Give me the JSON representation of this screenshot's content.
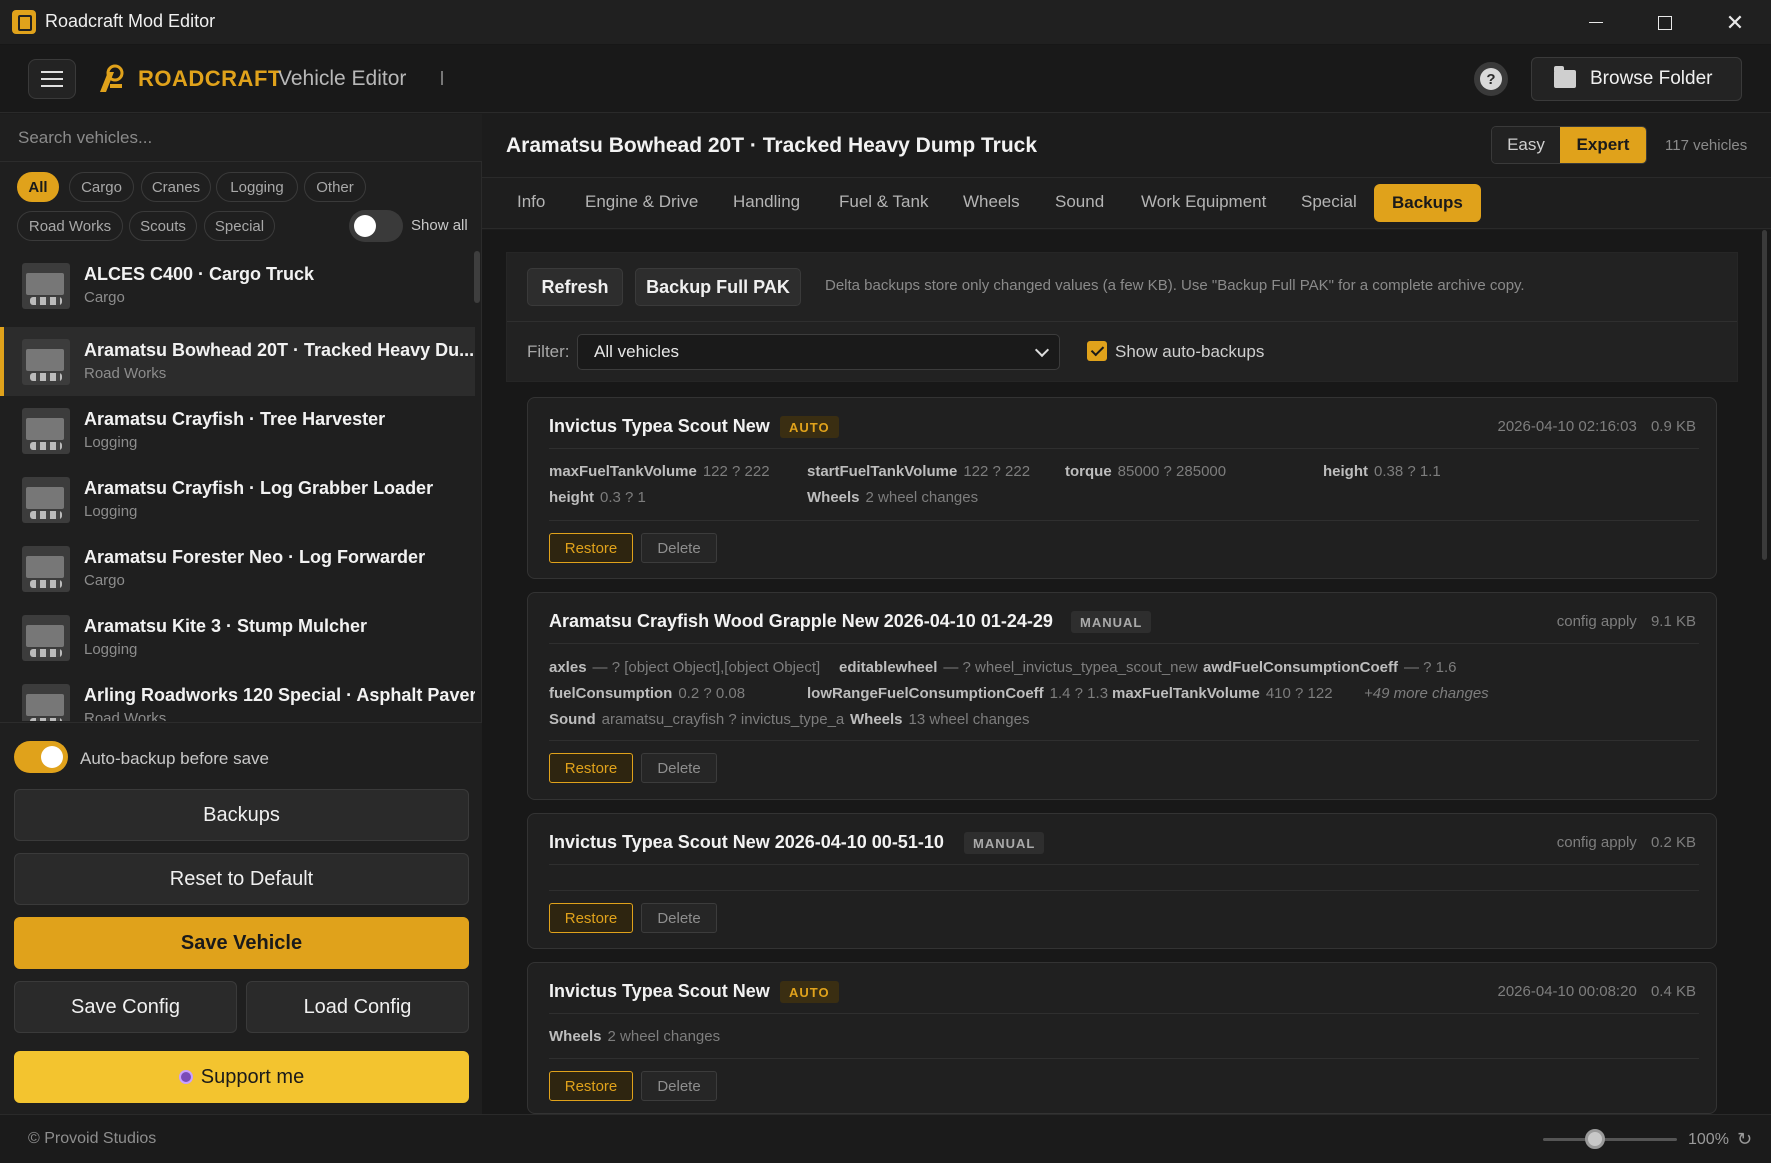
{
  "window": {
    "title": "Roadcraft Mod Editor"
  },
  "header": {
    "brand": "ROADCRAFT",
    "subtitle": "Vehicle Editor",
    "help": "?",
    "browse_label": "Browse Folder"
  },
  "sidebar": {
    "search_placeholder": "Search vehicles...",
    "filters": [
      "All",
      "Cargo",
      "Cranes",
      "Logging",
      "Other",
      "Road Works",
      "Scouts",
      "Special"
    ],
    "active_filter": "All",
    "show_all_label": "Show all",
    "vehicles": [
      {
        "name": "ALCES C400 · Cargo Truck",
        "category": "Cargo"
      },
      {
        "name": "Aramatsu Bowhead 20T · Tracked Heavy Du...",
        "category": "Road Works"
      },
      {
        "name": "Aramatsu Crayfish · Tree Harvester",
        "category": "Logging"
      },
      {
        "name": "Aramatsu Crayfish · Log Grabber Loader",
        "category": "Logging"
      },
      {
        "name": "Aramatsu Forester Neo · Log Forwarder",
        "category": "Cargo"
      },
      {
        "name": "Aramatsu Kite 3 · Stump Mulcher",
        "category": "Logging"
      },
      {
        "name": "Arling Roadworks 120 Special · Asphalt Paver",
        "category": "Road Works"
      }
    ],
    "selected_index": 1,
    "autobackup_label": "Auto-backup before save",
    "buttons": {
      "backups": "Backups",
      "reset": "Reset to Default",
      "save_vehicle": "Save Vehicle",
      "save_config": "Save Config",
      "load_config": "Load Config",
      "support": "Support me"
    }
  },
  "status": {
    "copyright": "© Provoid Studios",
    "zoom": "100%",
    "zoom_reset": "↻"
  },
  "main": {
    "title": "Aramatsu Bowhead 20T · Tracked Heavy Dump Truck",
    "modes": [
      "Easy",
      "Expert"
    ],
    "active_mode": "Expert",
    "vehicle_count": "117 vehicles",
    "tabs": [
      "Info",
      "Engine & Drive",
      "Handling",
      "Fuel & Tank",
      "Wheels",
      "Sound",
      "Work Equipment",
      "Special",
      "Backups"
    ],
    "active_tab": "Backups"
  },
  "backups": {
    "refresh_label": "Refresh",
    "full_pak_label": "Backup Full PAK",
    "hint": "Delta backups store only changed values (a few KB). Use \"Backup Full PAK\" for a complete archive copy.",
    "filter_label": "Filter:",
    "filter_value": "All vehicles",
    "show_auto_label": "Show auto-backups",
    "show_auto_checked": true,
    "restore_label": "Restore",
    "delete_label": "Delete",
    "items": [
      {
        "title": "Invictus Typea Scout New",
        "badge": "AUTO",
        "date": "2026-04-10 02:16:03",
        "size": "0.9 KB",
        "changes": [
          {
            "k": "maxFuelTankVolume",
            "v": "122 ? 222"
          },
          {
            "k": "startFuelTankVolume",
            "v": "122 ? 222"
          },
          {
            "k": "torque",
            "v": "85000 ? 285000"
          },
          {
            "k": "height",
            "v": "0.38 ? 1.1"
          },
          {
            "k": "height",
            "v": "0.3 ? 1"
          },
          {
            "k": "Wheels",
            "v": "2 wheel changes"
          }
        ]
      },
      {
        "title": "Aramatsu Crayfish Wood Grapple New 2026-04-10 01-24-29",
        "badge": "MANUAL",
        "date": "config apply",
        "size": "9.1 KB",
        "changes": [
          {
            "k": "axles",
            "v": "— ? [object Object],[object Object]"
          },
          {
            "k": "editablewheel",
            "v": "— ? wheel_invictus_typea_scout_new"
          },
          {
            "k": "awdFuelConsumptionCoeff",
            "v": "— ? 1.6"
          },
          {
            "k": "fuelConsumption",
            "v": "0.2 ? 0.08"
          },
          {
            "k": "lowRangeFuelConsumptionCoeff",
            "v": "1.4 ? 1.3"
          },
          {
            "k": "maxFuelTankVolume",
            "v": "410 ? 122"
          },
          {
            "k": "Sound",
            "v": "aramatsu_crayfish ? invictus_type_a"
          },
          {
            "k": "Wheels",
            "v": "13 wheel changes"
          }
        ],
        "more": "+49 more changes"
      },
      {
        "title": "Invictus Typea Scout New 2026-04-10 00-51-10",
        "badge": "MANUAL",
        "date": "config apply",
        "size": "0.2 KB",
        "changes": []
      },
      {
        "title": "Invictus Typea Scout New",
        "badge": "AUTO",
        "date": "2026-04-10 00:08:20",
        "size": "0.4 KB",
        "changes": [
          {
            "k": "Wheels",
            "v": "2 wheel changes"
          }
        ]
      }
    ]
  },
  "colors": {
    "accent": "#e0a21b",
    "support": "#f3c42f",
    "background": "#1c1c1c"
  }
}
